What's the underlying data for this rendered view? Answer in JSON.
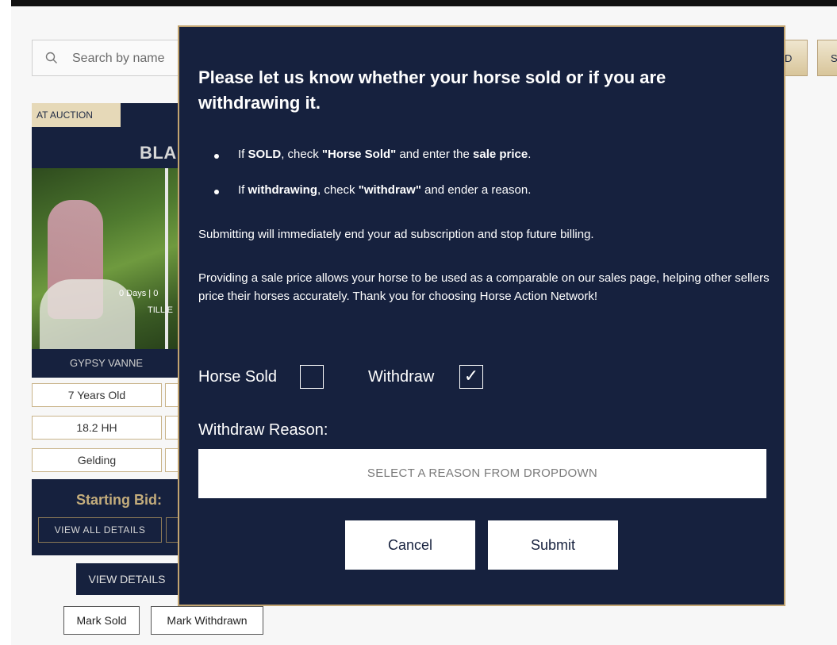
{
  "search": {
    "placeholder": "Search by name"
  },
  "top_buttons": [
    "D",
    "S"
  ],
  "listing": {
    "badge": "AT AUCTION",
    "name_partial": "BLAK",
    "days_partial": "0 Days | 0",
    "till_partial": "TILL E",
    "breed_partial": "GYPSY VANNE",
    "attributes": [
      "7 Years Old",
      "18.2 HH",
      "Gelding"
    ],
    "bid_label": "Starting Bid:",
    "view_all_details": "VIEW ALL DETAILS",
    "view_details": "VIEW DETAILS",
    "mark_sold": "Mark Sold",
    "mark_withdrawn": "Mark Withdrawn"
  },
  "modal": {
    "title": "Please let us know whether your horse sold or if you are withdrawing it.",
    "bullet1": {
      "pre": "If ",
      "b1": "SOLD",
      "mid1": ", check ",
      "b2": "\"Horse Sold\"",
      "mid2": " and enter the ",
      "b3": "sale price",
      "post": "."
    },
    "bullet2": {
      "pre": "If ",
      "b1": "withdrawing",
      "mid1": ", check ",
      "b2": "\"withdraw\"",
      "post": " and ender a reason."
    },
    "para1": "Submitting will immediately end your ad subscription and stop future billing.",
    "para2": "Providing a sale price allows your horse to be used as a comparable on our sales page, helping other sellers price their horses accurately. Thank you for choosing Horse Action Network!",
    "horse_sold_label": "Horse Sold",
    "horse_sold_checked": false,
    "withdraw_label": "Withdraw",
    "withdraw_checked": true,
    "checkmark": "✓",
    "reason_label": "Withdraw Reason:",
    "reason_placeholder": "SELECT A REASON FROM DROPDOWN",
    "cancel_label": "Cancel",
    "submit_label": "Submit"
  }
}
